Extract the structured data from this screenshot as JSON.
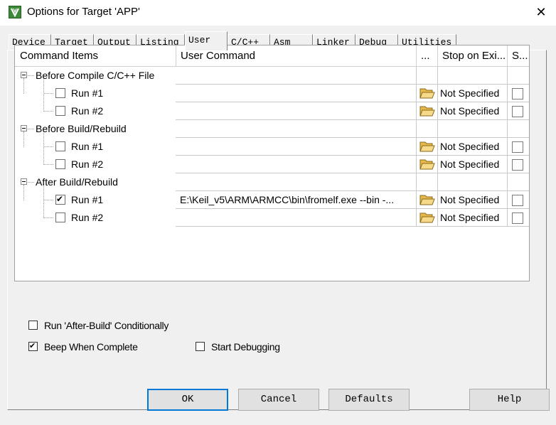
{
  "window": {
    "title": "Options for Target 'APP'",
    "app_icon": "keil-uvision-icon",
    "close_glyph": "✕"
  },
  "tabs": [
    {
      "label": "Device",
      "active": false
    },
    {
      "label": "Target",
      "active": false
    },
    {
      "label": "Output",
      "active": false
    },
    {
      "label": "Listing",
      "active": false
    },
    {
      "label": "User",
      "active": true
    },
    {
      "label": "C/C++",
      "active": false
    },
    {
      "label": "Asm",
      "active": false
    },
    {
      "label": "Linker",
      "active": false
    },
    {
      "label": "Debug",
      "active": false
    },
    {
      "label": "Utilities",
      "active": false
    }
  ],
  "grid": {
    "headers": {
      "items": "Command Items",
      "command": "User Command",
      "browse": "...",
      "stop": "Stop on Exi...",
      "s": "S..."
    },
    "groups": [
      {
        "label": "Before Compile C/C++ File",
        "items": [
          {
            "label": "Run #1",
            "checked": false,
            "command": "",
            "stop": "Not Specified"
          },
          {
            "label": "Run #2",
            "checked": false,
            "command": "",
            "stop": "Not Specified"
          }
        ]
      },
      {
        "label": "Before Build/Rebuild",
        "items": [
          {
            "label": "Run #1",
            "checked": false,
            "command": "",
            "stop": "Not Specified"
          },
          {
            "label": "Run #2",
            "checked": false,
            "command": "",
            "stop": "Not Specified"
          }
        ]
      },
      {
        "label": "After Build/Rebuild",
        "items": [
          {
            "label": "Run #1",
            "checked": true,
            "command": "E:\\Keil_v5\\ARM\\ARMCC\\bin\\fromelf.exe --bin -...",
            "stop": "Not Specified"
          },
          {
            "label": "Run #2",
            "checked": false,
            "command": "",
            "stop": "Not Specified"
          }
        ]
      }
    ]
  },
  "options": {
    "run_after_build": {
      "label": "Run 'After-Build' Conditionally",
      "checked": false
    },
    "beep": {
      "label": "Beep When Complete",
      "checked": true
    },
    "start_debugging": {
      "label": "Start Debugging",
      "checked": false
    }
  },
  "buttons": {
    "ok": "OK",
    "cancel": "Cancel",
    "defaults": "Defaults",
    "help": "Help"
  },
  "checkmark_glyph": "✔"
}
